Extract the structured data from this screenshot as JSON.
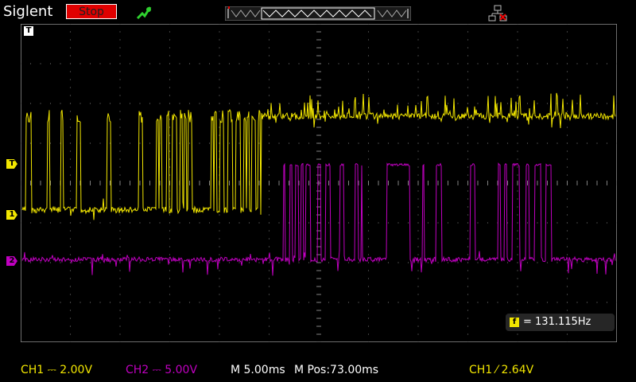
{
  "header": {
    "brand": "Siglent",
    "run_state": "Stop",
    "trigger_icon": "trigger-status-icon",
    "memory_icon": "memory-depth-indicator",
    "usb_icon": "usb-connection-icon"
  },
  "markers": {
    "top_t": "T",
    "trigger_level": "T",
    "ch1": "1",
    "ch2": "2"
  },
  "measurement": {
    "icon": "f",
    "value": "= 131.115Hz"
  },
  "status_bar": {
    "ch1": "CH1 ⎓ 2.00V",
    "ch2": "CH2 ⎓ 5.00V",
    "timebase": "M 5.00ms",
    "mpos": "M Pos:73.00ms",
    "trigger": "CH1 ⁄ 2.64V"
  },
  "colors": {
    "ch1": "#f2e600",
    "ch2": "#c000c0",
    "grid": "#808080",
    "stop": "#e00000"
  }
}
